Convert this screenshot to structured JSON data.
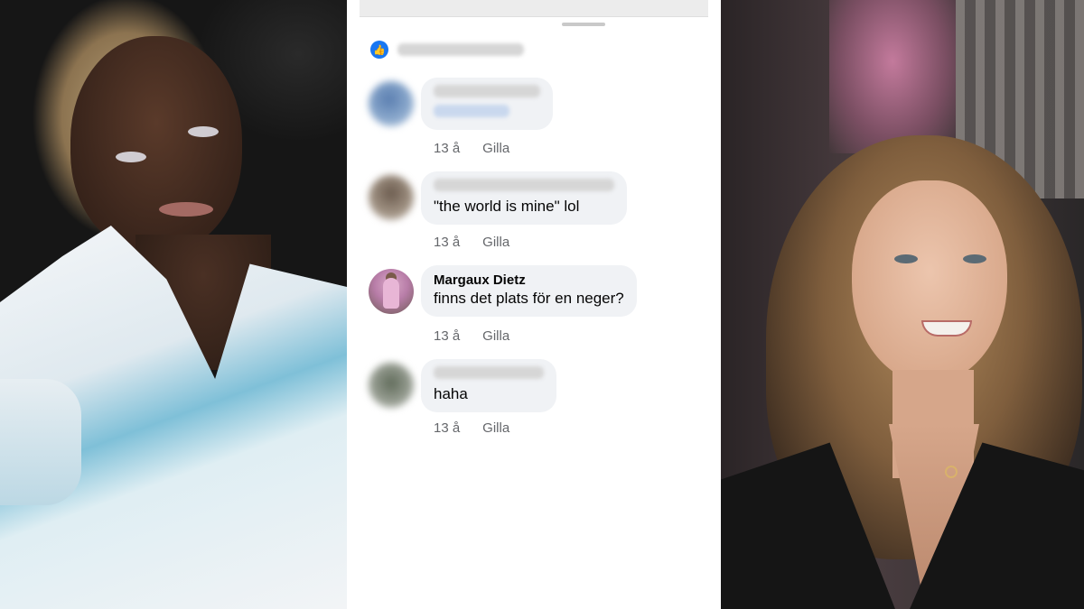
{
  "likes": {
    "icon": "thumbs-up-icon",
    "color": "#1877f2"
  },
  "comments": [
    {
      "name": "",
      "text": "",
      "time": "13 å",
      "like_label": "Gilla"
    },
    {
      "name": "",
      "text": "\"the world is mine\" lol",
      "time": "13 å",
      "like_label": "Gilla"
    },
    {
      "name": "Margaux Dietz",
      "text": "finns det plats för en neger?",
      "time": "13 å",
      "like_label": "Gilla"
    },
    {
      "name": "",
      "text": "haha",
      "time": "13 å",
      "like_label": "Gilla"
    }
  ]
}
